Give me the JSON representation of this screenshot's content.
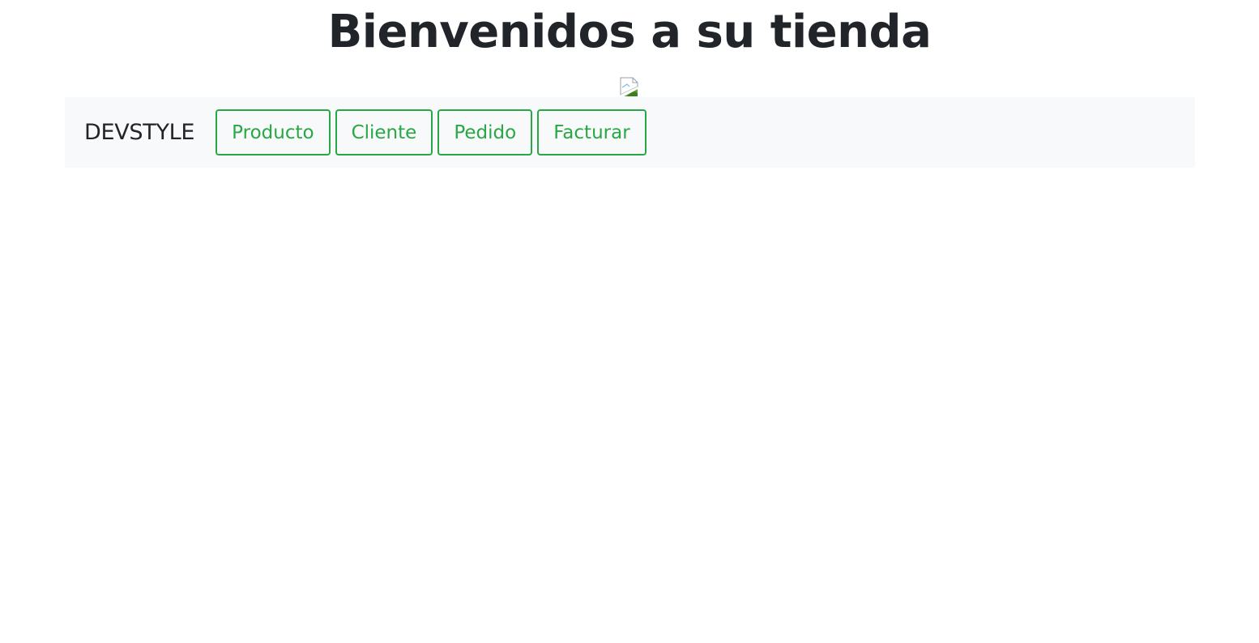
{
  "header": {
    "title": "Bienvenidos a su tienda"
  },
  "logo_image": {
    "state": "broken-image",
    "icon": "broken-image-icon"
  },
  "navbar": {
    "brand": "DEVSTYLE",
    "buttons": [
      {
        "label": "Producto"
      },
      {
        "label": "Cliente"
      },
      {
        "label": "Pedido"
      },
      {
        "label": "Facturar"
      }
    ]
  },
  "colors": {
    "accent": "#28a745",
    "navbar_bg": "#f8f9fa",
    "text": "#212529"
  }
}
